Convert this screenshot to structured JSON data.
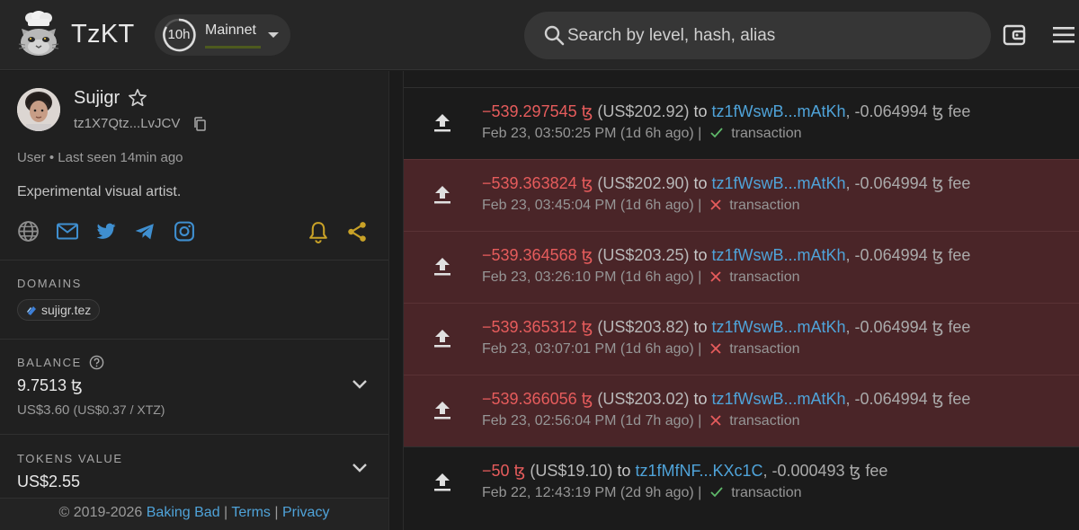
{
  "header": {
    "brand": "TzKT",
    "cycle_left": "10h",
    "network": "Mainnet",
    "search_placeholder": "Search by level, hash, alias"
  },
  "account": {
    "name": "Sujigr",
    "address": "tz1X7Qtz...LvJCV",
    "type_line": "User • Last seen 14min ago",
    "bio": "Experimental visual artist."
  },
  "domains": {
    "title": "DOMAINS",
    "items": [
      "sujigr.tez"
    ]
  },
  "balance": {
    "title": "BALANCE",
    "value": "9.7513 ꜩ",
    "usd": "US$3.60",
    "rate": "(US$0.37 / XTZ)"
  },
  "tokens": {
    "title": "TOKENS VALUE",
    "value": "US$2.55"
  },
  "footer": {
    "copyright": "© 2019-2026",
    "company": "Baking Bad",
    "sep": "|",
    "terms": "Terms",
    "privacy": "Privacy"
  },
  "operations": [
    {
      "amount": "−539.297545 ꜩ",
      "usd": "(US$202.92)",
      "to": "to",
      "target": "tz1fWswB...mAtKh",
      "fee": ", -0.064994 ꜩ fee",
      "time": "Feb 23, 03:50:25 PM (1d 6h ago)",
      "sep": "|",
      "kind": "transaction",
      "status": "applied"
    },
    {
      "amount": "−539.363824 ꜩ",
      "usd": "(US$202.90)",
      "to": "to",
      "target": "tz1fWswB...mAtKh",
      "fee": ", -0.064994 ꜩ fee",
      "time": "Feb 23, 03:45:04 PM (1d 6h ago)",
      "sep": "|",
      "kind": "transaction",
      "status": "failed"
    },
    {
      "amount": "−539.364568 ꜩ",
      "usd": "(US$203.25)",
      "to": "to",
      "target": "tz1fWswB...mAtKh",
      "fee": ", -0.064994 ꜩ fee",
      "time": "Feb 23, 03:26:10 PM (1d 6h ago)",
      "sep": "|",
      "kind": "transaction",
      "status": "failed"
    },
    {
      "amount": "−539.365312 ꜩ",
      "usd": "(US$203.82)",
      "to": "to",
      "target": "tz1fWswB...mAtKh",
      "fee": ", -0.064994 ꜩ fee",
      "time": "Feb 23, 03:07:01 PM (1d 6h ago)",
      "sep": "|",
      "kind": "transaction",
      "status": "failed"
    },
    {
      "amount": "−539.366056 ꜩ",
      "usd": "(US$203.02)",
      "to": "to",
      "target": "tz1fWswB...mAtKh",
      "fee": ", -0.064994 ꜩ fee",
      "time": "Feb 23, 02:56:04 PM (1d 7h ago)",
      "sep": "|",
      "kind": "transaction",
      "status": "failed"
    },
    {
      "amount": "−50 ꜩ",
      "usd": "(US$19.10)",
      "to": "to",
      "target": "tz1fMfNF...KXc1C",
      "fee": ", -0.000493 ꜩ fee",
      "time": "Feb 22, 12:43:19 PM (2d 9h ago)",
      "sep": "|",
      "kind": "transaction",
      "status": "applied"
    }
  ],
  "colors": {
    "accent": "#4fa3d9",
    "negative": "#e65c5c",
    "failed_row": "#4a2528",
    "success": "#5fb86a",
    "bell": "#c9a227"
  },
  "icons": [
    "tzkt-cat-logo",
    "search-icon",
    "wallet-icon",
    "menu-icon",
    "star-icon",
    "copy-icon",
    "globe-icon",
    "mail-icon",
    "twitter-icon",
    "telegram-icon",
    "instagram-icon",
    "bell-icon",
    "share-icon",
    "help-icon",
    "chevron-down-icon",
    "outgoing-arrow-icon",
    "check-icon",
    "cross-icon"
  ]
}
